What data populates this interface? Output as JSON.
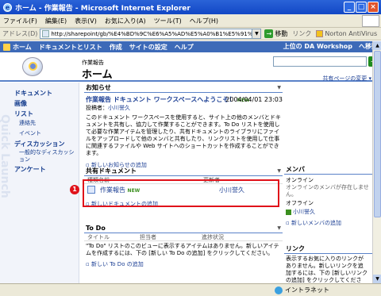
{
  "window": {
    "title": "ホーム - 作業報告 - Microsoft Internet Explorer"
  },
  "menu": [
    "ファイル(F)",
    "編集(E)",
    "表示(V)",
    "お気に入り(A)",
    "ツール(T)",
    "ヘルプ(H)"
  ],
  "address": {
    "label": "アドレス(D)",
    "url": "http://sharepoint/gb/%E4%BD%9C%E6%A5%AD%E5%A0%B1%E5%91%8A/defa",
    "go": "移動",
    "links": "リンク",
    "norton": "Norton AntiVirus"
  },
  "spnav": {
    "items": [
      "ホーム",
      "ドキュメントとリスト",
      "作成",
      "サイトの設定",
      "ヘルプ"
    ],
    "right": [
      "上位の DA Workshop",
      "へ移動"
    ]
  },
  "header": {
    "subtitle": "作業報告",
    "title": "ホーム",
    "view_link": "共有ページの変更 ▾"
  },
  "leftnav": {
    "watermark": "Quick Launch",
    "items": [
      {
        "label": "ドキュメント",
        "sub": []
      },
      {
        "label": "画像",
        "sub": []
      },
      {
        "label": "リスト",
        "sub": [
          "連絡先",
          "イベント"
        ]
      },
      {
        "label": "ディスカッション",
        "sub": [
          "一般的なディスカッション"
        ]
      },
      {
        "label": "アンケート",
        "sub": []
      }
    ]
  },
  "announcements": {
    "title": "お知らせ",
    "item_title": "作業報告 ドキュメント ワークスペースへようこそ！",
    "new_tag": "NEW",
    "date": "2004/04/01 23:03",
    "poster_label": "投稿者：",
    "poster": "小川誉久",
    "body": "このドキュメント ワークスペースを使用すると、サイト上の他のメンバとドキュメントを共有し、協力して作業することができます。To Do リストを使用して必要な作業アイテムを管理したり、共有ドキュメントのライブラリにファイルをアップロードして他のメンバと共有したり、リンクリストを使用して仕事に関連するファイルや Web サイトへのショートカットを作成することができます。",
    "add": "新しいお知らせの追加"
  },
  "shared_docs": {
    "title": "共有ドキュメント",
    "headers": [
      "種類",
      "名前",
      "更新者"
    ],
    "rows": [
      {
        "name": "作業報告",
        "new_tag": "NEW",
        "modified_by": "小川誉久"
      }
    ],
    "add": "新しいドキュメントの追加"
  },
  "todo": {
    "title": "To Do",
    "headers": [
      "タイトル",
      "担当者",
      "進捗状況"
    ],
    "empty": "\"To Do\" リストのこのビューに表示するアイテムはありません。新しいアイテムを作成するには、下の [新しい To Do の追加] をクリックしてください。",
    "add": "新しい To Do の追加"
  },
  "members": {
    "title": "メンバ",
    "online": "オンライン",
    "online_empty": "オンラインのメンバが存在しません。",
    "offline": "オフライン",
    "offline_user": "小川誉久",
    "add": "新しいメンバの追加"
  },
  "links": {
    "title": "リンク",
    "body": "表示するお気に入りのリンクがありません。新しいリンクを追加するには、下の [新しいリンクの追加] をクリックしてください。"
  },
  "callout": {
    "number": "1"
  },
  "status": {
    "zone": "イントラネット"
  },
  "colors": {
    "accent": "#3d6ab8",
    "highlight": "#e0121a"
  }
}
